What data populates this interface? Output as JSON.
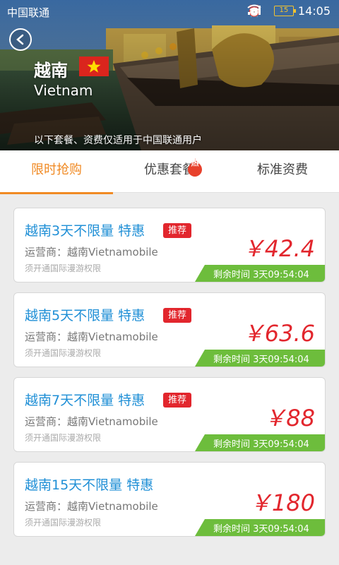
{
  "status": {
    "carrier": "中国联通",
    "battery": "15",
    "time": "14:05"
  },
  "header": {
    "country": "越南",
    "country_en": "Vietnam",
    "notice": "以下套餐、资费仅适用于中国联通用户",
    "flag_color": "#da251d",
    "star_color": "#ffde00"
  },
  "tabs": [
    {
      "label": "限时抢购",
      "active": true
    },
    {
      "label": "优惠套餐",
      "badge": "热"
    },
    {
      "label": "标准资费"
    }
  ],
  "colors": {
    "accent": "#f08a24",
    "title": "#1f8fd6",
    "price": "#e2262d",
    "timer": "#6dbd3c"
  },
  "packages": [
    {
      "title": "越南3天不限量 特惠",
      "tag": "推荐",
      "operator": "运营商：越南Vietnamobile",
      "note": "须开通国际漫游权限",
      "price": "￥42.4",
      "timer": "剩余时间 3天09:54:04"
    },
    {
      "title": "越南5天不限量 特惠",
      "tag": "推荐",
      "operator": "运营商：越南Vietnamobile",
      "note": "须开通国际漫游权限",
      "price": "￥63.6",
      "timer": "剩余时间 3天09:54:04"
    },
    {
      "title": "越南7天不限量 特惠",
      "tag": "推荐",
      "operator": "运营商：越南Vietnamobile",
      "note": "须开通国际漫游权限",
      "price": "￥88",
      "timer": "剩余时间 3天09:54:04"
    },
    {
      "title": "越南15天不限量 特惠",
      "tag": "",
      "operator": "运营商：越南Vietnamobile",
      "note": "须开通国际漫游权限",
      "price": "￥180",
      "timer": "剩余时间 3天09:54:04"
    }
  ]
}
